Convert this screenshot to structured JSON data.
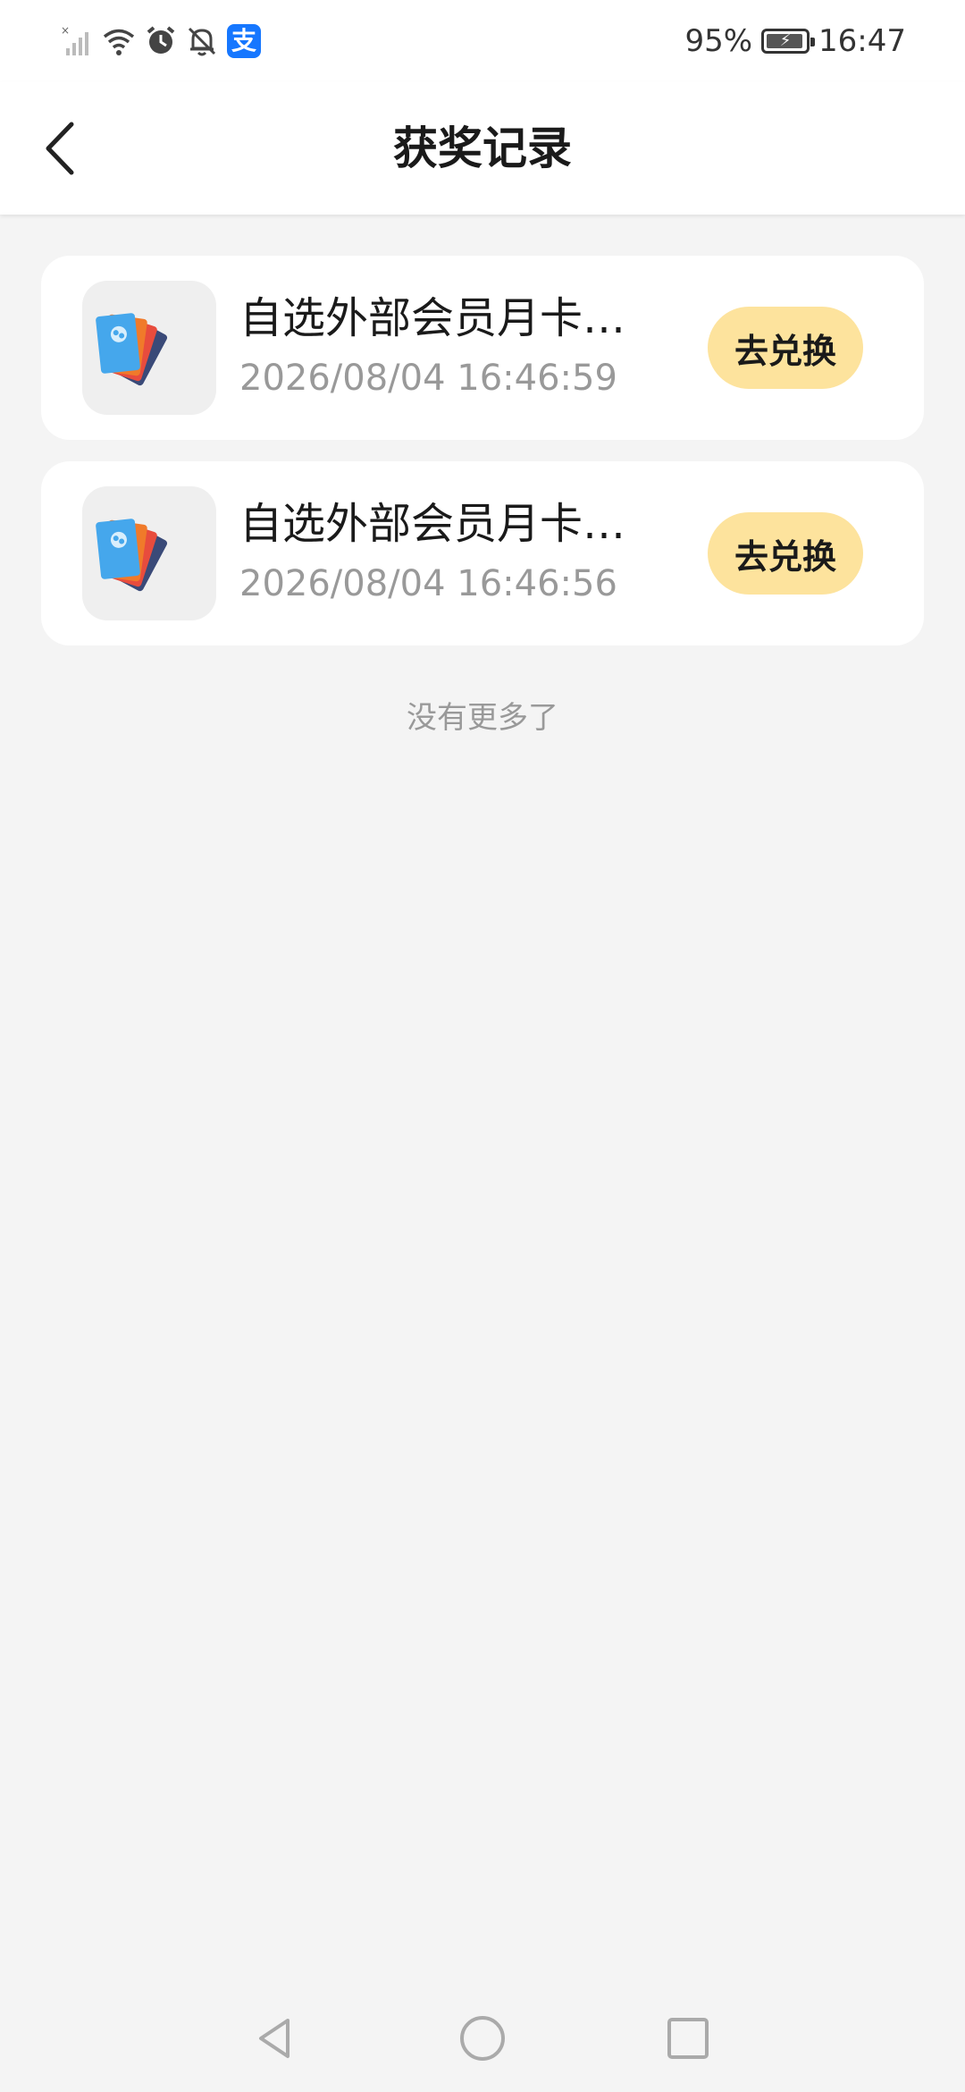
{
  "status_bar": {
    "battery": "95%",
    "time": "16:47",
    "icons": [
      "no-signal-icon",
      "wifi-icon",
      "alarm-icon",
      "mute-bell-icon",
      "alipay-icon"
    ],
    "alipay_glyph": "支"
  },
  "header": {
    "title": "获奖记录",
    "back_icon": "chevron-left-icon"
  },
  "records": [
    {
      "title": "自选外部会员月卡…",
      "time": "2026/08/04 16:46:59",
      "button": "去兑换",
      "thumb_icon": "membership-cards-icon"
    },
    {
      "title": "自选外部会员月卡…",
      "time": "2026/08/04 16:46:56",
      "button": "去兑换",
      "thumb_icon": "membership-cards-icon"
    }
  ],
  "footer": {
    "no_more": "没有更多了"
  },
  "nav": {
    "items": [
      "back-triangle-icon",
      "home-circle-icon",
      "recents-square-icon"
    ]
  },
  "colors": {
    "accent_button": "#fde39d",
    "background": "#f4f4f4",
    "muted_text": "#999999"
  }
}
